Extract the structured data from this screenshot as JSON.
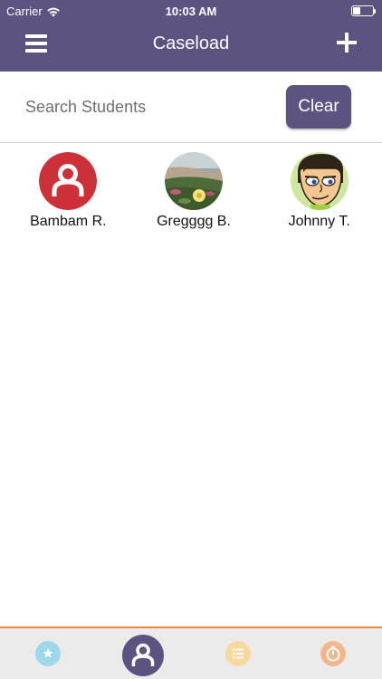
{
  "status_bar": {
    "carrier": "Carrier",
    "time": "10:03 AM"
  },
  "nav": {
    "title": "Caseload",
    "menu_icon": "hamburger-menu-icon",
    "add_icon": "plus-icon"
  },
  "search": {
    "placeholder": "Search Students",
    "value": "",
    "clear_label": "Clear"
  },
  "students": [
    {
      "name": "Bambam R.",
      "avatar": "default-person-avatar",
      "avatar_color": "#cc3139"
    },
    {
      "name": "Gregggg B.",
      "avatar": "flower-photo-avatar"
    },
    {
      "name": "Johnny T.",
      "avatar": "cartoon-face-avatar"
    }
  ],
  "tabs": [
    {
      "icon": "star-icon",
      "color": "#7ecbe3"
    },
    {
      "icon": "person-icon",
      "color": "#5d5381",
      "active": true
    },
    {
      "icon": "list-icon",
      "color": "#f7d38a"
    },
    {
      "icon": "timer-icon",
      "color": "#f2a87a"
    }
  ],
  "colors": {
    "header": "#5d5381",
    "accent": "#ee8a3d",
    "tab_bar": "#ebebeb"
  }
}
